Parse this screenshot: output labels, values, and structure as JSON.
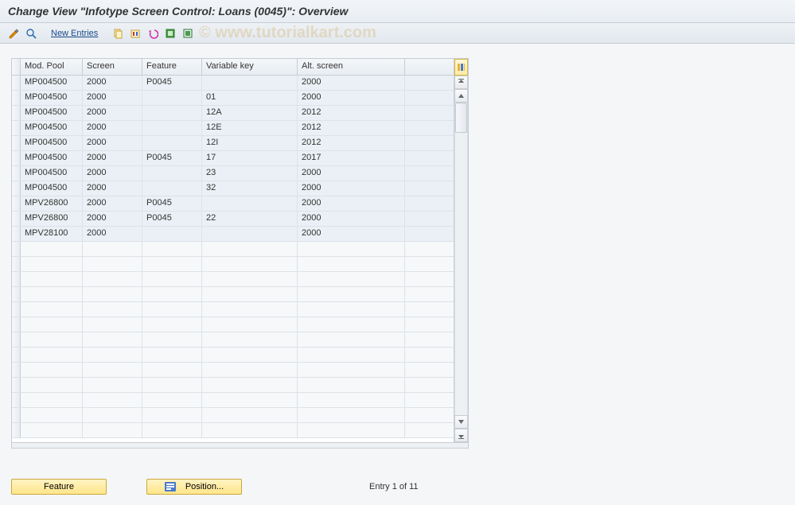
{
  "title": "Change View \"Infotype Screen Control: Loans (0045)\": Overview",
  "watermark": "© www.tutorialkart.com",
  "toolbar": {
    "new_entries": "New Entries"
  },
  "grid": {
    "columns": [
      "Mod. Pool",
      "Screen",
      "Feature",
      "Variable key",
      "Alt. screen"
    ],
    "rows": [
      {
        "modpool": "MP004500",
        "screen": "2000",
        "feature": "P0045",
        "varkey": "",
        "altscr": "2000"
      },
      {
        "modpool": "MP004500",
        "screen": "2000",
        "feature": "",
        "varkey": "01",
        "altscr": "2000"
      },
      {
        "modpool": "MP004500",
        "screen": "2000",
        "feature": "",
        "varkey": "12A",
        "altscr": "2012"
      },
      {
        "modpool": "MP004500",
        "screen": "2000",
        "feature": "",
        "varkey": "12E",
        "altscr": "2012"
      },
      {
        "modpool": "MP004500",
        "screen": "2000",
        "feature": "",
        "varkey": "12I",
        "altscr": "2012"
      },
      {
        "modpool": "MP004500",
        "screen": "2000",
        "feature": "P0045",
        "varkey": "17",
        "altscr": "2017"
      },
      {
        "modpool": "MP004500",
        "screen": "2000",
        "feature": "",
        "varkey": "23",
        "altscr": "2000"
      },
      {
        "modpool": "MP004500",
        "screen": "2000",
        "feature": "",
        "varkey": "32",
        "altscr": "2000"
      },
      {
        "modpool": "MPV26800",
        "screen": "2000",
        "feature": "P0045",
        "varkey": "",
        "altscr": "2000"
      },
      {
        "modpool": "MPV26800",
        "screen": "2000",
        "feature": "P0045",
        "varkey": "22",
        "altscr": "2000"
      },
      {
        "modpool": "MPV28100",
        "screen": "2000",
        "feature": "",
        "varkey": "",
        "altscr": "2000"
      }
    ],
    "empty_rows": 13
  },
  "footer": {
    "feature_btn": "Feature",
    "position_btn": "Position...",
    "status": "Entry 1 of 11"
  }
}
